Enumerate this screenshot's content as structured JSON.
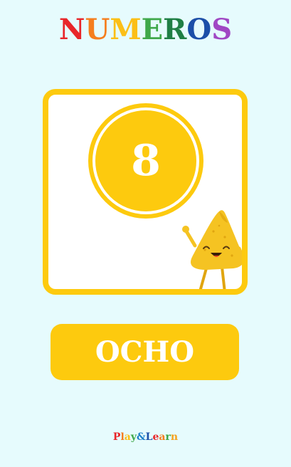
{
  "app": {
    "title_letters": [
      {
        "char": "N",
        "color": "#e8262a"
      },
      {
        "char": "U",
        "color": "#f57e1e"
      },
      {
        "char": "M",
        "color": "#fbbf17"
      },
      {
        "char": "E",
        "color": "#3fa84a"
      },
      {
        "char": "R",
        "color": "#1f7f45"
      },
      {
        "char": "O",
        "color": "#1c4fa8"
      },
      {
        "char": "S",
        "color": "#a047c4"
      }
    ]
  },
  "card": {
    "number": "8"
  },
  "word_button": {
    "label": "OCHO"
  },
  "footer": {
    "brand_letters": [
      {
        "char": "P",
        "color": "#e8262a"
      },
      {
        "char": "l",
        "color": "#f57e1e"
      },
      {
        "char": "a",
        "color": "#fbbf17"
      },
      {
        "char": "y",
        "color": "#3fa84a"
      },
      {
        "char": "&",
        "color": "#1c7fc9"
      },
      {
        "char": "L",
        "color": "#1c4fa8"
      },
      {
        "char": "e",
        "color": "#e8262a"
      },
      {
        "char": "a",
        "color": "#f57e1e"
      },
      {
        "char": "r",
        "color": "#3fa84a"
      },
      {
        "char": "n",
        "color": "#f5a21e"
      }
    ]
  },
  "colors": {
    "background": "#e6fbfd",
    "accent": "#fdca0e",
    "card_bg": "#ffffff"
  },
  "icons": {
    "mascot": "nacho-chip-mascot-icon"
  }
}
